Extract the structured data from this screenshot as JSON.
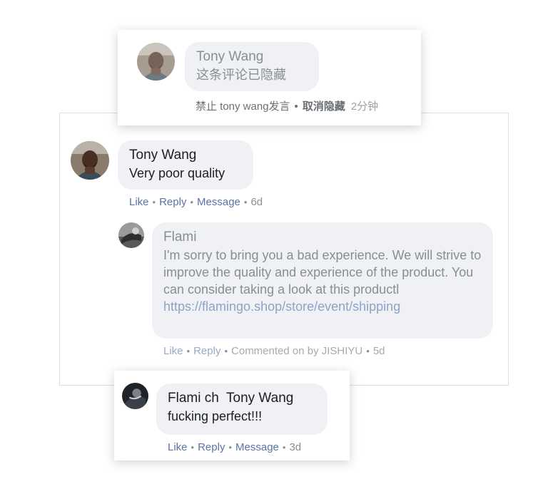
{
  "hidden_comment": {
    "author": "Tony Wang",
    "text": "这条评论已隐藏",
    "action_ban": "禁止 tony wang发言",
    "action_unhide": "取消隐藏",
    "time": "2分钟"
  },
  "main_comment": {
    "author": "Tony Wang",
    "text": "Very poor quality",
    "actions": {
      "like": "Like",
      "reply": "Reply",
      "message": "Message",
      "time": "6d"
    }
  },
  "reply": {
    "author": "Flami",
    "text": "I'm sorry to bring you a bad experience. We will strive to improve the quality and experience of the product. You can consider taking a look at this productl",
    "link": "https://flamingo.shop/store/event/shipping",
    "actions": {
      "like": "Like",
      "reply": "Reply",
      "commented_on_by": "Commented on by JISHIYU",
      "time": "5d"
    }
  },
  "bottom_comment": {
    "author": "Flami ch  Tony Wang",
    "text": "fucking perfect!!!",
    "actions": {
      "like": "Like",
      "reply": "Reply",
      "message": "Message",
      "time": "3d"
    }
  },
  "colors": {
    "link_blue": "#5b73a5",
    "bubble_bg": "#eff1f4",
    "muted_text": "#8a8d91"
  }
}
